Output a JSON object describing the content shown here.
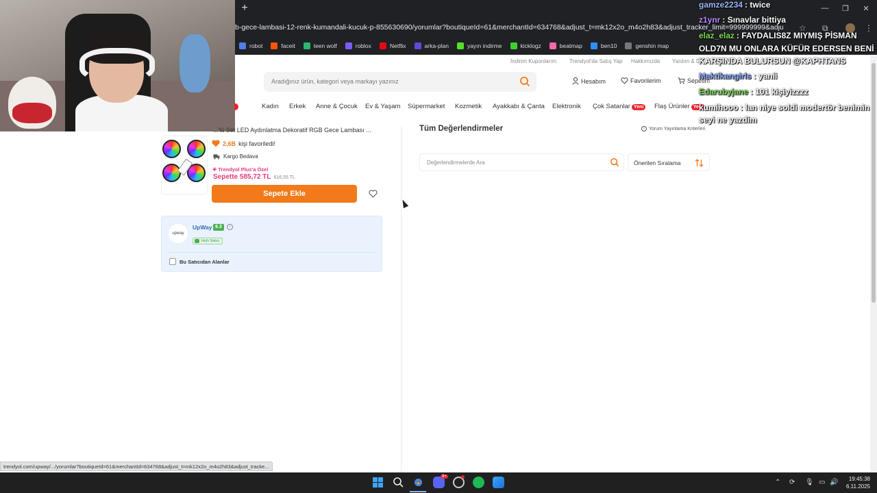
{
  "browser": {
    "new_tab_label": "+",
    "address": "b-gece-lambasi-12-renk-kumandali-kucuk-p-855630690/yorumlar?boutiqueId=61&merchantId=634768&adjust_t=mk12x2o_m4o2h83&adjust_tracker_limit=999999999&adjust_campaign=produc...",
    "bookmarks": [
      {
        "label": "robot",
        "icon": "robot-icon",
        "color": "#4f7ee8"
      },
      {
        "label": "faceit",
        "icon": "faceit-icon",
        "color": "#ff5500"
      },
      {
        "label": "teen wolf",
        "icon": "teen-wolf-icon",
        "color": "#2bb673"
      },
      {
        "label": "roblox",
        "icon": "roblox-icon",
        "color": "#7a5cfa"
      },
      {
        "label": "Netflix",
        "icon": "netflix-icon",
        "color": "#e50914"
      },
      {
        "label": "arka-plan",
        "icon": "arka-plan-icon",
        "color": "#5b4bd6"
      },
      {
        "label": "yayın indirme",
        "icon": "yayin-indirme-icon",
        "color": "#53e026"
      },
      {
        "label": "kicklogz",
        "icon": "kicklogz-icon",
        "color": "#3fcf2f"
      },
      {
        "label": "beatmap",
        "icon": "beatmap-icon",
        "color": "#ff66aa"
      },
      {
        "label": "ben10",
        "icon": "ben10-icon",
        "color": "#2f8cff"
      },
      {
        "label": "genshin map",
        "icon": "genshin-map-icon",
        "color": "#777777"
      }
    ]
  },
  "topstrip": {
    "coupons": "İndirim Kuponlarım",
    "sell": "Trendyol'da Satış Yap",
    "about": "Hakkımızda",
    "help": "Yardım & De"
  },
  "search": {
    "placeholder": "Aradığınız ürün, kategori veya markayı yazınız"
  },
  "account": {
    "account": "Hesabım",
    "favorites": "Favorilerim",
    "cart": "Sepetim"
  },
  "categories": [
    "Kadın",
    "Erkek",
    "Anne & Çocuk",
    "Ev & Yaşam",
    "Süpermarket",
    "Kozmetik",
    "Ayakkabı & Çanta",
    "Elektronik",
    "Çok Satanlar",
    "Flaş Ürünler"
  ],
  "badge_new": "Yeni",
  "product": {
    "title": "...'lü Set LED Aydınlatma Dekoratif RGB Gece Lambası ...",
    "favorites_count": "2,6B",
    "favorites_text": "kişi favoriledi!",
    "cargo": "Kargo Bedava",
    "plus_label": "Trendyol Plus'a Özel",
    "cart_price": "Sepette 585,72 TL",
    "old_price": "616,55 TL",
    "add_to_cart": "Sepete Ekle"
  },
  "seller": {
    "logo_text": "upway",
    "name": "UpWay",
    "score": "9.3",
    "badge": "Hızlı Satıcı",
    "filter_label": "Bu Satıcıdan Alanlar"
  },
  "reviews": {
    "title": "Tüm Değerlendirmeler",
    "rules": "Yorum Yayınlama Kriterleri",
    "search_placeholder": "Değerlendirmelerde Ara",
    "sort_label": "Önerilen Sıralama"
  },
  "status_url": "trendyol.com/upway/.../yorumlar?boutiqueId=61&merchantId=634768&adjust_t=mk12x2o_m4o2h83&adjust_tracke...",
  "chat": [
    {
      "user": "gamze2234",
      "text": ": twice",
      "color": "#9fb8ff"
    },
    {
      "user": "z1ynr",
      "text": ": Sınavlar bittiya",
      "color": "#b88cff"
    },
    {
      "user": "elaz_elaz",
      "text": ": FAYDALIS8Z MIYMIŞ PİSMAN",
      "color": "#7ed957"
    },
    {
      "user": "",
      "text": "OLD7N MU ONLARA KÜFÜR EDERSEN BENİ",
      "color": "#ffffff"
    },
    {
      "user": "",
      "text": "KARŞINDA BULURSUN @KAPHTANS",
      "color": "#ffffff"
    },
    {
      "user": "Maktikangirls",
      "text": ": yanii",
      "color": "#8aa9ff"
    },
    {
      "user": "Edarubyjane",
      "text": ": 101 kişiyizzzz",
      "color": "#7ed957"
    },
    {
      "user": "kumihooo",
      "text": ": lan niye soldi modertör benimin",
      "color": "#ffffff"
    },
    {
      "user": "",
      "text": "seyi ne yazdim",
      "color": "#ffffff"
    }
  ],
  "taskbar": {
    "time": "19:45:38",
    "date": "6.11.2025",
    "discord_badge": "9+"
  }
}
